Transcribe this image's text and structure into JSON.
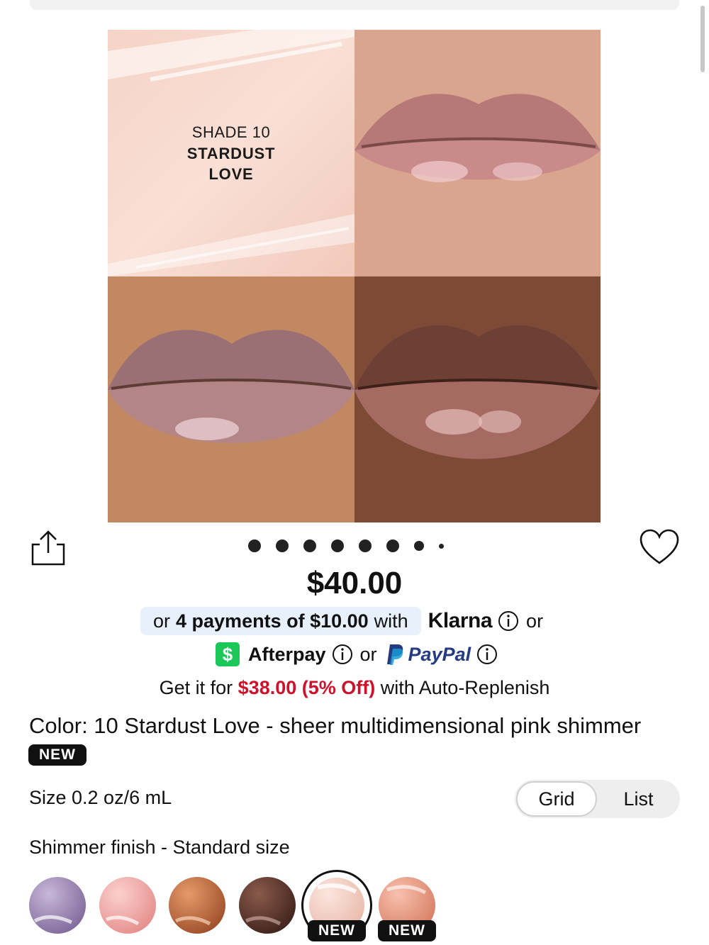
{
  "hero": {
    "shade_number": "SHADE 10",
    "shade_name_line1": "STARDUST",
    "shade_name_line2": "LOVE",
    "carousel_dot_count": 8
  },
  "price": "$40.00",
  "payments": {
    "klarna_prefix": "or",
    "klarna_bold": "4 payments of $10.00",
    "klarna_suffix": "with",
    "klarna_brand": "Klarna",
    "or1": "or",
    "afterpay_logo": "$",
    "afterpay_brand": "Afterpay",
    "or2": "or",
    "paypal_brand": "PayPal"
  },
  "auto_replenish": {
    "prefix": "Get it for",
    "discount": "$38.00 (5% Off)",
    "suffix": "with Auto-Replenish"
  },
  "color_line": "Color: 10 Stardust Love - sheer multidimensional pink shimmer",
  "new_badge": "NEW",
  "size_line": "Size 0.2 oz/6 mL",
  "view_toggle": {
    "grid": "Grid",
    "list": "List",
    "selected": "Grid"
  },
  "finish_line": "Shimmer finish - Standard size",
  "swatches": [
    {
      "color": "#9b86b4",
      "selected": false,
      "badge": ""
    },
    {
      "color": "#f2a7a6",
      "selected": false,
      "badge": ""
    },
    {
      "color": "#c66d3e",
      "selected": false,
      "badge": ""
    },
    {
      "color": "#5b3328",
      "selected": false,
      "badge": ""
    },
    {
      "color": "#f3d2c6",
      "selected": true,
      "badge": "NEW"
    },
    {
      "color": "#e9957d",
      "selected": false,
      "badge": "NEW"
    }
  ],
  "colors": {
    "accent_red": "#cf112c",
    "klarna_bg": "#e8f1fb",
    "afterpay_green": "#1cc75a",
    "paypal_blue": "#253b80"
  },
  "icons": [
    "share-icon",
    "heart-icon",
    "info-icon",
    "afterpay-logo",
    "paypal-logo"
  ]
}
